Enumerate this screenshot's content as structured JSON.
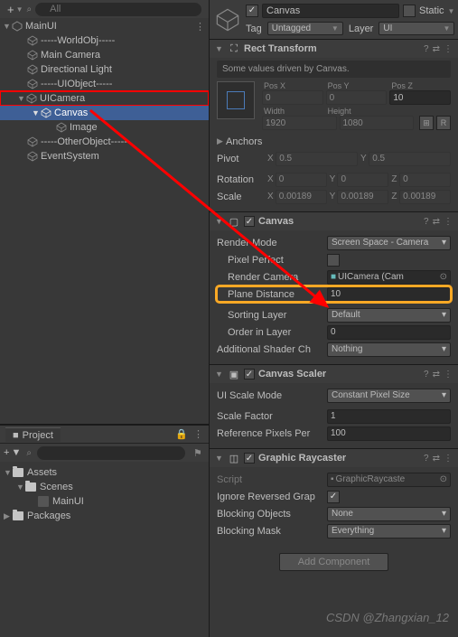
{
  "hierarchy": {
    "search_placeholder": "All",
    "scene": {
      "name": "MainUI"
    },
    "items": [
      {
        "name": "-----WorldObj-----"
      },
      {
        "name": "Main Camera"
      },
      {
        "name": "Directional Light"
      },
      {
        "name": "-----UIObject-----"
      },
      {
        "name": "UICamera"
      },
      {
        "name": "Canvas"
      },
      {
        "name": "Image"
      },
      {
        "name": "-----OtherObject-----"
      },
      {
        "name": "EventSystem"
      }
    ]
  },
  "project": {
    "tab": "Project",
    "root": "Assets",
    "scenes_folder": "Scenes",
    "scene_asset": "MainUI",
    "packages": "Packages"
  },
  "inspector": {
    "go_name": "Canvas",
    "static_label": "Static",
    "tag_label": "Tag",
    "tag_value": "Untagged",
    "layer_label": "Layer",
    "layer_value": "UI",
    "rect_transform": {
      "title": "Rect Transform",
      "info": "Some values driven by Canvas.",
      "pos_x_label": "Pos X",
      "pos_x": "0",
      "pos_y_label": "Pos Y",
      "pos_y": "0",
      "pos_z_label": "Pos Z",
      "pos_z": "10",
      "width_label": "Width",
      "width": "1920",
      "height_label": "Height",
      "height": "1080",
      "anchors_label": "Anchors",
      "pivot_label": "Pivot",
      "pivot_x": "0.5",
      "pivot_y": "0.5",
      "rotation_label": "Rotation",
      "rot_x": "0",
      "rot_y": "0",
      "rot_z": "0",
      "scale_label": "Scale",
      "scale_x": "0.00189",
      "scale_y": "0.00189",
      "scale_z": "0.00189"
    },
    "canvas": {
      "title": "Canvas",
      "render_mode_label": "Render Mode",
      "render_mode": "Screen Space - Camera",
      "pixel_perfect_label": "Pixel Perfect",
      "render_camera_label": "Render Camera",
      "render_camera": "UICamera (Cam",
      "plane_distance_label": "Plane Distance",
      "plane_distance": "10",
      "sorting_layer_label": "Sorting Layer",
      "sorting_layer": "Default",
      "order_label": "Order in Layer",
      "order": "0",
      "addl_shader_label": "Additional Shader Ch",
      "addl_shader": "Nothing"
    },
    "canvas_scaler": {
      "title": "Canvas Scaler",
      "scale_mode_label": "UI Scale Mode",
      "scale_mode": "Constant Pixel Size",
      "scale_factor_label": "Scale Factor",
      "scale_factor": "1",
      "ref_pixels_label": "Reference Pixels Per",
      "ref_pixels": "100"
    },
    "raycaster": {
      "title": "Graphic Raycaster",
      "script_label": "Script",
      "script": "GraphicRaycaste",
      "ignore_label": "Ignore Reversed Grap",
      "blocking_obj_label": "Blocking Objects",
      "blocking_obj": "None",
      "blocking_mask_label": "Blocking Mask",
      "blocking_mask": "Everything"
    },
    "add_component": "Add Component"
  },
  "watermark": "CSDN @Zhangxian_12"
}
